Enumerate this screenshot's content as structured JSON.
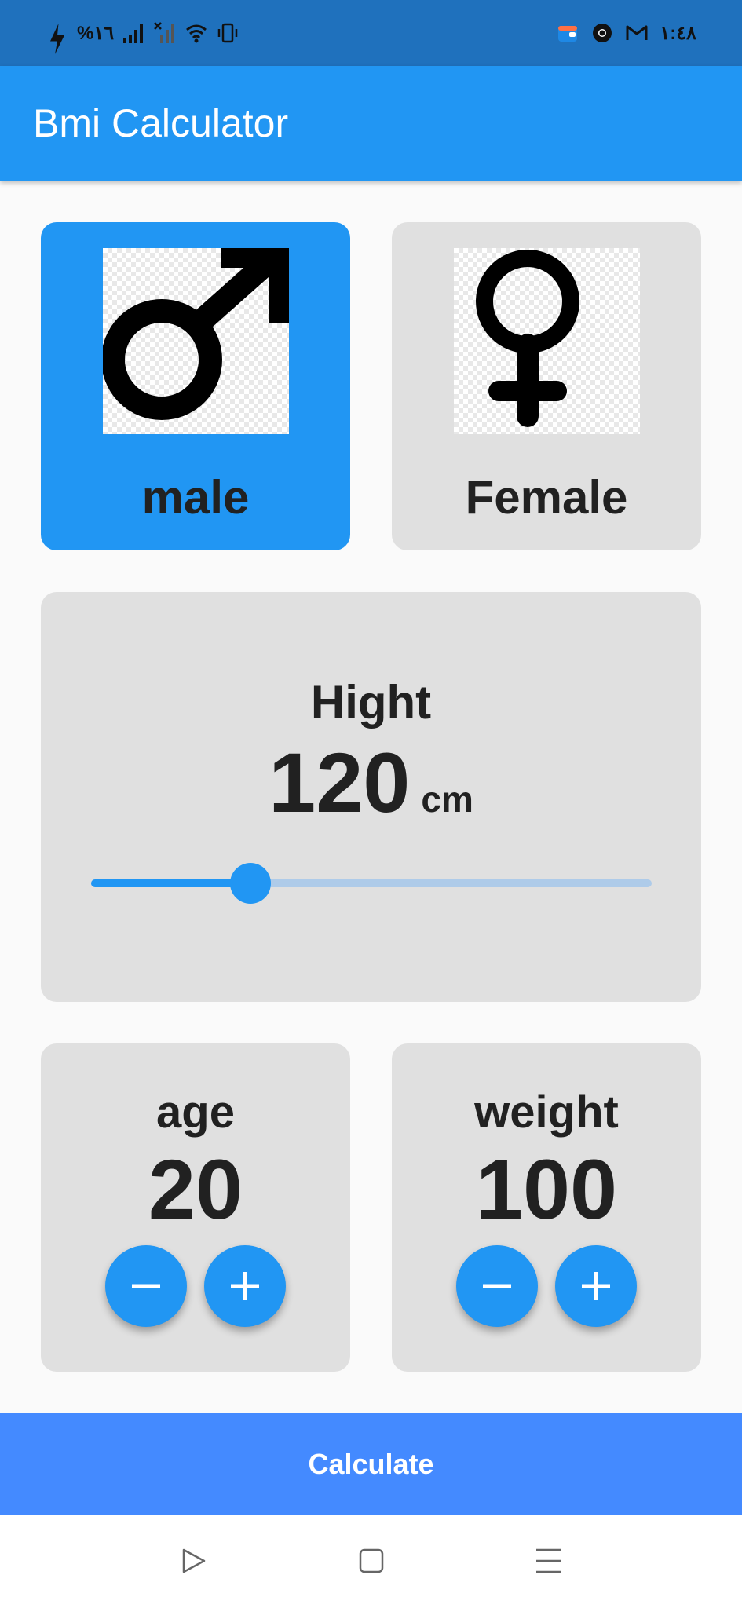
{
  "status_bar": {
    "battery_text": "%١٦",
    "time": "١:٤٨",
    "icons": [
      "charging-icon",
      "signal-icon",
      "signal-off-icon",
      "wifi-icon",
      "vibrate-icon",
      "wallet-app-icon",
      "chrome-icon",
      "gmail-icon"
    ]
  },
  "app_bar": {
    "title": "Bmi Calculator"
  },
  "gender": {
    "male": {
      "label": "male",
      "icon": "male-symbol-icon",
      "selected": true
    },
    "female": {
      "label": "Female",
      "icon": "female-symbol-icon",
      "selected": false
    }
  },
  "height": {
    "title": "Hight",
    "value": "120",
    "unit": "cm",
    "slider_fraction": 0.285
  },
  "age": {
    "label": "age",
    "value": "20",
    "minus_icon": "minus-icon",
    "plus_icon": "plus-icon"
  },
  "weight": {
    "label": "weight",
    "value": "100",
    "minus_icon": "minus-icon",
    "plus_icon": "plus-icon"
  },
  "calculate": {
    "label": "Calculate"
  },
  "nav": {
    "icons": [
      "back-triangle-icon",
      "home-square-icon",
      "menu-lines-icon"
    ]
  },
  "colors": {
    "primary": "#2196f3",
    "status_bar": "#1f71bd",
    "card": "#e0e0e0",
    "calculate_bar": "#448aff",
    "slider_inactive": "#aecbe9"
  }
}
